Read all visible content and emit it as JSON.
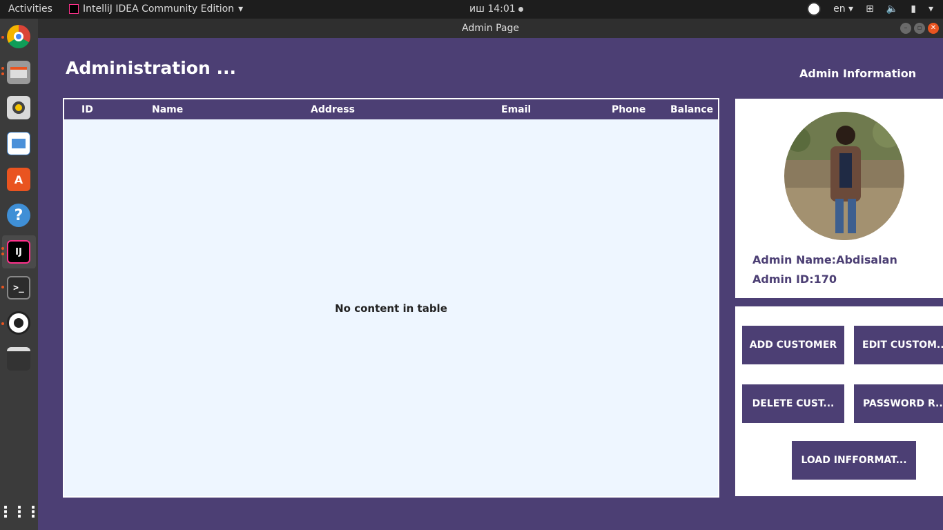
{
  "topbar": {
    "activities": "Activities",
    "app_name": "IntelliJ IDEA Community Edition",
    "time": "иш 14:01",
    "lang": "en"
  },
  "window": {
    "title": "Admin Page"
  },
  "page": {
    "title": "Administration ...",
    "admin_info_title": "Admin Information"
  },
  "table": {
    "columns": [
      "ID",
      "Name",
      "Address",
      "Email",
      "Phone",
      "Balance"
    ],
    "empty_text": "No content in table"
  },
  "admin": {
    "name_label": "Admin Name:Abdisalan",
    "id_label": "Admin ID:170"
  },
  "buttons": {
    "add": "ADD CUSTOMER",
    "edit": "EDIT CUSTOM...",
    "delete": "DELETE CUST...",
    "password": "PASSWORD R...",
    "load": "LOAD INFFORMAT..."
  },
  "colors": {
    "primary": "#4c3f74",
    "table_bg": "#eef6ff",
    "accent": "#e95420"
  },
  "dock_icons": [
    "chrome-icon",
    "files-icon",
    "rhythmbox-icon",
    "writer-icon",
    "software-icon",
    "help-icon",
    "intellij-icon",
    "terminal-icon",
    "obs-icon",
    "clapper-icon",
    "apps-grid-icon"
  ]
}
